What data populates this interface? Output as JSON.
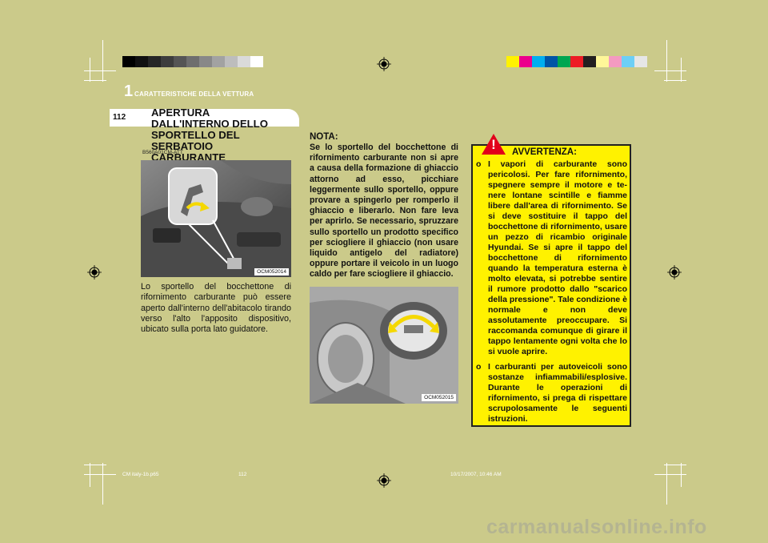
{
  "header": {
    "chapter_number": "1",
    "chapter_title": "CARATTERISTICHE DELLA VETTURA",
    "page_number": "112"
  },
  "section": {
    "title": "APERTURA DALL'INTERNO DELLO SPORTELLO DEL SERBATOIO CARBURANTE",
    "code": "B560A01CM-ATT",
    "photo1_caption": "OCM052014",
    "body": "Lo sportello del bocchettone di rifornimento carburante può essere aperto dall'interno dell'abitacolo tirando verso l'alto l'apposito dispositivo, ubicato sulla porta lato guidatore."
  },
  "nota": {
    "title": "NOTA:",
    "text": "Se lo sportello del bocchettone di rifornimento carburante non si apre a causa della formazione di ghiaccio attorno ad esso, picchiare leggermente sullo sportello, oppure provare a spingerlo per romperlo il ghiaccio e liberarlo. Non fare leva per aprirlo. Se necessario, spruzzare sullo sportello un prodotto specifico per sciogliere il ghiaccio (non usare liquido antigelo del radiatore) oppure portare il veicolo in un luogo caldo per fare sciogliere il ghiaccio.",
    "photo2_caption": "OCM052015"
  },
  "warning": {
    "icon": "!",
    "title": "AVVERTENZA:",
    "bullet": "o",
    "item1": "I vapori di carburante sono pericolosi. Per fare rifornimento, spegnere sempre il motore e te-nere lontane scintille e fiamme libere dall'area di rifornimento. Se si deve sostituire il tappo del bocchettone di rifornimento, usare un pezzo di ricambio originale Hyundai. Se si apre il tappo del bocchettone di rifornimento quando la temperatura esterna è molto elevata, si potrebbe sentire il rumore prodotto dallo \"scarico della pressione\". Tale condizione è normale e non deve assolutamente preoccupare. Si raccomanda comunque di girare il tappo lentamente ogni volta che lo si vuole aprire.",
    "item2": "I carburanti per autoveicoli sono sostanze infiammabili/esplosive. Durante le operazioni di rifornimento, si prega di rispettare scrupolosamente le seguenti istruzioni."
  },
  "footer": {
    "file": "CM italy-1b.p65",
    "page": "112",
    "datetime": "10/17/2007, 10:46 AM"
  },
  "watermark": "carmanualsonline.info",
  "colors": {
    "page_bg": "#cbca8a",
    "warning_bg": "#fff200",
    "warning_icon": "#e2001a"
  }
}
